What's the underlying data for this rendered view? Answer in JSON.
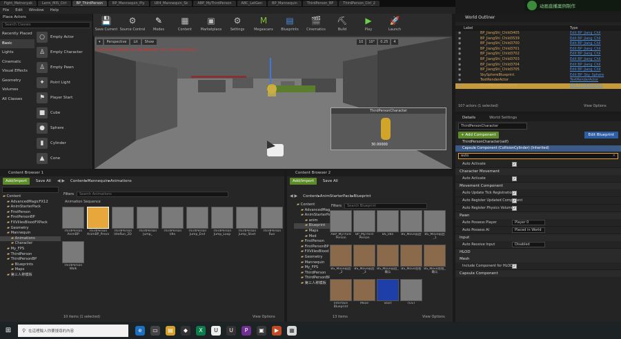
{
  "title_tabs": [
    "Fight_Metronyxk",
    "Lerm_MIS_Ctrl",
    "BP_ThirdPerson",
    "BP_Mannequin_Ply",
    "UE4_Mannequin_Sk",
    "ABP_MyThirdPerson",
    "ABC_LetGen",
    "BP_Mannequin",
    "ThirdPerson_BP",
    "ThirdPerson_Ctrl_2"
  ],
  "menu": [
    "File",
    "Edit",
    "Window",
    "Help"
  ],
  "overlay_brand": "动画直播案例制作",
  "toolbar": [
    "Save Current",
    "Source Control",
    "Modes",
    "Content",
    "Marketplace",
    "Settings",
    "Megascans",
    "Blueprints",
    "Cinematics",
    "Build",
    "Play",
    "Launch"
  ],
  "place_actors": {
    "title": "Place Actors",
    "search_placeholder": "Search Classes",
    "categories": [
      "Recently Placed",
      "Basic",
      "Lights",
      "Cinematic",
      "Visual Effects",
      "Geometry",
      "Volumes",
      "All Classes"
    ],
    "selected_category": "Basic",
    "actors": [
      "Empty Actor",
      "Empty Character",
      "Empty Pawn",
      "Point Light",
      "Player Start",
      "Cube",
      "Sphere",
      "Cylinder",
      "Cone"
    ]
  },
  "viewport": {
    "perspective": "Perspective",
    "lit": "Lit",
    "show": "Show",
    "warning": "LIGHTING NEEDS TO BE REBUILT (10 unbuilt objects)",
    "grid_snap": "10",
    "rot_snap": "10°",
    "scale_snap": "0.25",
    "cam_speed": "4",
    "pip_title": "ThirdPersonCharacter",
    "pip_num": "30.00000"
  },
  "outliner": {
    "title": "World Outliner",
    "col_label": "Label",
    "col_type": "Type",
    "rows": [
      {
        "label": "BP_JiangShi_Child3405",
        "type": "Edit BP_Jiang_Chil"
      },
      {
        "label": "BP_JiangShi_Child3539",
        "type": "Edit BP_Jiang_Chil"
      },
      {
        "label": "BP_JiangShi_Child3700",
        "type": "Edit BP_Jiang_Chil"
      },
      {
        "label": "BP_JiangShi_Child3701",
        "type": "Edit BP_Jiang_Chil"
      },
      {
        "label": "BP_JiangShi_Child3702",
        "type": "Edit BP_Jiang_Chil"
      },
      {
        "label": "BP_JiangShi_Child3703",
        "type": "Edit BP_Jiang_Chil"
      },
      {
        "label": "BP_JiangShi_Child3704",
        "type": "Edit BP_Jiang_Chil"
      },
      {
        "label": "BP_JiangShi_Child3705",
        "type": "Edit BP_Jiang_Chil"
      },
      {
        "label": "SkySphereBlueprint",
        "type": "Edit BP_Sky_Sphere"
      },
      {
        "label": "TextRenderActor",
        "type": "TextRenderActor"
      },
      {
        "label": "ThirdPersonCharacter",
        "type": "Edit ThirdPersonCh"
      }
    ],
    "count": "107 actors (1 selected)",
    "view_options": "View Options"
  },
  "details": {
    "tab1": "Details",
    "tab2": "World Settings",
    "name": "ThirdPersonCharacter",
    "add_component": "+ Add Component",
    "edit_blueprint": "Edit Blueprint",
    "self": "ThirdPersonCharacter(self)",
    "capsule": "Capsule Component (CollisionCylinder) (Inherited)",
    "search": "auto",
    "rows": [
      {
        "kind": "prop",
        "label": "Auto Activate",
        "value": "check"
      },
      {
        "kind": "sec",
        "label": "Character Movement"
      },
      {
        "kind": "prop",
        "label": "Auto Activate",
        "value": "check"
      },
      {
        "kind": "sec",
        "label": "Movement Component"
      },
      {
        "kind": "prop",
        "label": "Auto Update Tick Registration",
        "value": "check"
      },
      {
        "kind": "prop",
        "label": "Auto Register Updated Component",
        "value": "check"
      },
      {
        "kind": "prop",
        "label": "Auto Register Physics Volume U",
        "value": "check"
      },
      {
        "kind": "sec",
        "label": "Pawn"
      },
      {
        "kind": "prop",
        "label": "Auto Possess Player",
        "value": "Player 0"
      },
      {
        "kind": "prop",
        "label": "Auto Possess AI",
        "value": "Placed in World"
      },
      {
        "kind": "sec",
        "label": "Input"
      },
      {
        "kind": "prop",
        "label": "Auto Receive Input",
        "value": "Disabled"
      },
      {
        "kind": "sec",
        "label": "HLOD"
      },
      {
        "kind": "sec",
        "label": "Mesh"
      },
      {
        "kind": "prop",
        "label": "Include Component for HLOD",
        "value": "check"
      },
      {
        "kind": "sec",
        "label": "Capsule Component"
      }
    ]
  },
  "cb1": {
    "tab": "Content Browser 1",
    "add_import": "Add/Import",
    "save_all": "Save All",
    "path": [
      "Content",
      "Mannequin",
      "Animations"
    ],
    "search_placeholder": "Search Animations",
    "filters": "Filters",
    "group": "Animation Sequence",
    "tree": [
      {
        "t": "Content",
        "d": 0
      },
      {
        "t": "AdvancedMagicFX12",
        "d": 1
      },
      {
        "t": "AnimStarterPack",
        "d": 1
      },
      {
        "t": "FirstPerson",
        "d": 1
      },
      {
        "t": "FirstPersonBP",
        "d": 1
      },
      {
        "t": "FXVillesBloodFXPack",
        "d": 1
      },
      {
        "t": "Geometry",
        "d": 1
      },
      {
        "t": "Mannequin",
        "d": 1
      },
      {
        "t": "Animations",
        "d": 2,
        "sel": true
      },
      {
        "t": "Character",
        "d": 2
      },
      {
        "t": "My_FPS",
        "d": 1
      },
      {
        "t": "ThirdPerson",
        "d": 1
      },
      {
        "t": "ThirdPersonBP",
        "d": 1
      },
      {
        "t": "Blueprints",
        "d": 2
      },
      {
        "t": "Maps",
        "d": 2
      },
      {
        "t": "第三人称模板",
        "d": 1
      }
    ],
    "assets": [
      "ThirdPerson AnimBP",
      "ThirdPerson IdleRun_2D",
      "ThirdPerson Jump_",
      "ThirdPerson Idle",
      "ThirdPerson Jump_End",
      "ThirdPerson Jump_Loop",
      "ThirdPerson Jump_Start",
      "ThirdPerson Run",
      "ThirdPerson Walk"
    ],
    "selected_asset": "ThirdPerson AnimBP_Preview",
    "count": "10 items (1 selected)",
    "view_options": "View Options"
  },
  "cb2": {
    "tab": "Content Browser 2",
    "add_import": "Add/Import",
    "save_all": "Save All",
    "path": [
      "Content",
      "AnimStarterPack",
      "Blueprint"
    ],
    "search_placeholder": "Search Blueprint",
    "filters": "Filters",
    "tree": [
      {
        "t": "Content",
        "d": 0
      },
      {
        "t": "AdvancedMagic",
        "d": 1
      },
      {
        "t": "AnimStarterPa",
        "d": 1
      },
      {
        "t": "anim",
        "d": 2
      },
      {
        "t": "Blueprint",
        "d": 2,
        "sel": true
      },
      {
        "t": "Maps",
        "d": 2
      },
      {
        "t": "Mod",
        "d": 2
      },
      {
        "t": "FirstPerson",
        "d": 1
      },
      {
        "t": "FirstPersonBP",
        "d": 1
      },
      {
        "t": "FXVillesBlood",
        "d": 1
      },
      {
        "t": "Geometry",
        "d": 1
      },
      {
        "t": "Mannequin",
        "d": 1
      },
      {
        "t": "My_FPS",
        "d": 1
      },
      {
        "t": "ThirdPerson",
        "d": 1
      },
      {
        "t": "ThirdPersonBP",
        "d": 1
      },
      {
        "t": "第三人称模板",
        "d": 1
      }
    ],
    "assets": [
      "ABP_MyThird Person",
      "BP_MyThird Person",
      "BS_Idle",
      "BS_Move前后",
      "BS_Move前后_1",
      "BS_Move前后_2",
      "BS_Move前后_3",
      "BS_Move前后_确认",
      "BS_Move左右",
      "BS_Move左右_确认",
      "Interface Blueprint",
      "Move",
      "Start",
      "TEST"
    ],
    "count": "13 items",
    "view_options": "View Options"
  },
  "taskbar": {
    "search": "在這裡輸入你要搜尋的內容",
    "colors": {
      "accent": "#5d8b2a",
      "selected": "#e8a73a",
      "link": "#4d8fe0"
    }
  }
}
